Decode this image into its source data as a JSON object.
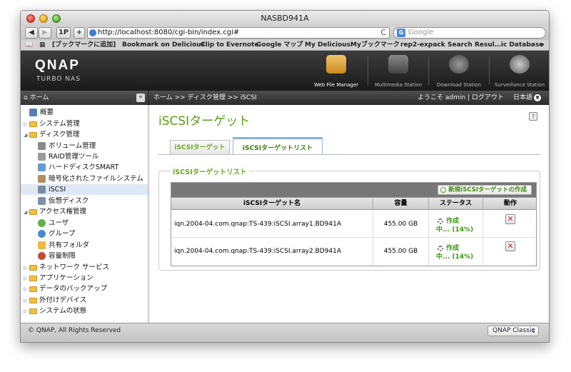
{
  "window": {
    "title": "NASBD941A"
  },
  "toolbar": {
    "back": "◀",
    "forward": "▶",
    "onep": "1P",
    "add": "+",
    "url": "http://localhost:8080/cgi-bin/index.cgi#",
    "reload": "C",
    "search_placeholder": "Google"
  },
  "bookmarks": [
    "[ブックマークに追加]",
    "Bookmark on Delicious",
    "Clip to Evernote",
    "Google マップ",
    "My Delicious",
    "Myブックマーク",
    "rep2-expack",
    "Search Resul…ic Database"
  ],
  "header": {
    "logo": "QNAP",
    "sublogo": "TURBO NAS",
    "apps": [
      "Web File Manager",
      "Multimedia Station",
      "Download Station",
      "Surveillance Station"
    ]
  },
  "nav": {
    "home": "ホーム",
    "breadcrumb": "ホーム >> ディスク管理 >> iSCSI",
    "welcome": "ようこそ admin | ログアウト",
    "language": "日本語"
  },
  "sidebar": {
    "items": [
      {
        "label": "概要"
      },
      {
        "label": "システム管理"
      },
      {
        "label": "ディスク管理"
      },
      {
        "label": "ボリューム管理"
      },
      {
        "label": "RAID管理ツール"
      },
      {
        "label": "ハードディスクSMART"
      },
      {
        "label": "暗号化されたファイルシステム"
      },
      {
        "label": "iSCSI"
      },
      {
        "label": "仮想ディスク"
      },
      {
        "label": "アクセス権管理"
      },
      {
        "label": "ユーザ"
      },
      {
        "label": "グループ"
      },
      {
        "label": "共有フォルダ"
      },
      {
        "label": "容量制限"
      },
      {
        "label": "ネットワーク サービス"
      },
      {
        "label": "アプリケーション"
      },
      {
        "label": "データのバックアップ"
      },
      {
        "label": "外付けデバイス"
      },
      {
        "label": "システムの状態"
      }
    ]
  },
  "main": {
    "title": "iSCSIターゲット",
    "help": "?",
    "tabs": [
      "iSCSIターゲット",
      "iSCSIターゲットリスト"
    ],
    "section": "iSCSIターゲットリスト",
    "create_button": "新規iSCSIターゲットの作成",
    "columns": [
      "iSCSIターゲット名",
      "容量",
      "ステータス",
      "動作"
    ],
    "rows": [
      {
        "name": "iqn.2004-04.com.qnap:TS-439:iSCSI.array1.BD941A",
        "capacity": "455.00 GB",
        "status_line1": "作成",
        "status_line2": "中... (14%)"
      },
      {
        "name": "iqn.2004-04.com.qnap:TS-439:iSCSI.array2.BD941A",
        "capacity": "455.00 GB",
        "status_line1": "作成",
        "status_line2": "中... (14%)"
      }
    ]
  },
  "footer": {
    "copyright": "© QNAP, All Rights Reserved",
    "theme": "QNAP Classic"
  }
}
